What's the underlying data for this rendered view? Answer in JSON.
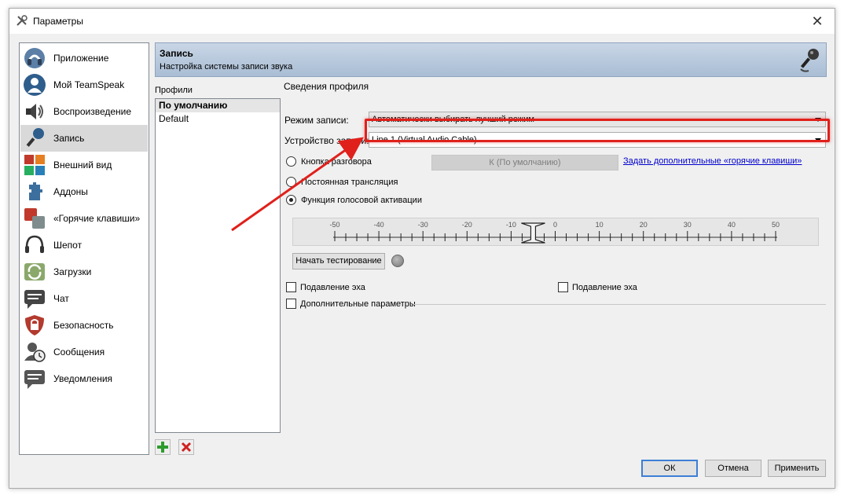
{
  "window": {
    "title": "Параметры",
    "close_symbol": "✕"
  },
  "sidebar": {
    "items": [
      {
        "label": "Приложение",
        "icon": "application-icon"
      },
      {
        "label": "Мой TeamSpeak",
        "icon": "user-icon"
      },
      {
        "label": "Воспроизведение",
        "icon": "speaker-icon"
      },
      {
        "label": "Запись",
        "icon": "microphone-icon",
        "selected": true
      },
      {
        "label": "Внешний вид",
        "icon": "palette-icon"
      },
      {
        "label": "Аддоны",
        "icon": "puzzle-icon"
      },
      {
        "label": "«Горячие клавиши»",
        "icon": "hotkeys-icon"
      },
      {
        "label": "Шепот",
        "icon": "headset-icon"
      },
      {
        "label": "Загрузки",
        "icon": "downloads-icon"
      },
      {
        "label": "Чат",
        "icon": "chat-icon"
      },
      {
        "label": "Безопасность",
        "icon": "shield-icon"
      },
      {
        "label": "Сообщения",
        "icon": "messages-icon"
      },
      {
        "label": "Уведомления",
        "icon": "notifications-icon"
      }
    ]
  },
  "header": {
    "title": "Запись",
    "subtitle": "Настройка системы записи звука"
  },
  "profiles": {
    "label": "Профили",
    "items": [
      {
        "label": "По умолчанию",
        "selected": true
      },
      {
        "label": "Default"
      }
    ]
  },
  "details": {
    "section_title": "Сведения профиля",
    "mode_label": "Режим записи:",
    "mode_value": "Автоматически выбирать лучший режим",
    "device_label": "Устройство записи:",
    "device_value": "Line 1 (Virtual Audio Cable)",
    "radio_ptt": "Кнопка разговора",
    "radio_continuous": "Постоянная трансляция",
    "radio_vad": "Функция голосовой активации",
    "selected_radio": "radio_vad",
    "hotkey_button": "К (По умолчанию)",
    "hotkey_link": "Задать дополнительные «горячие клавиши»",
    "meter_ticks": [
      "-50",
      "-40",
      "-30",
      "-20",
      "-10",
      "0",
      "10",
      "20",
      "30",
      "40",
      "50"
    ],
    "meter_threshold_db": -5,
    "test_button": "Начать тестирование",
    "echo1": "Подавление эха",
    "echo2": "Подавление эха",
    "advanced": "Дополнительные параметры"
  },
  "buttons": {
    "ok": "ОК",
    "cancel": "Отмена",
    "apply": "Применить"
  },
  "colors": {
    "highlight": "#e0201b",
    "header_top": "#c9d6e6",
    "header_bottom": "#a9bdd4",
    "link": "#0000cc"
  }
}
